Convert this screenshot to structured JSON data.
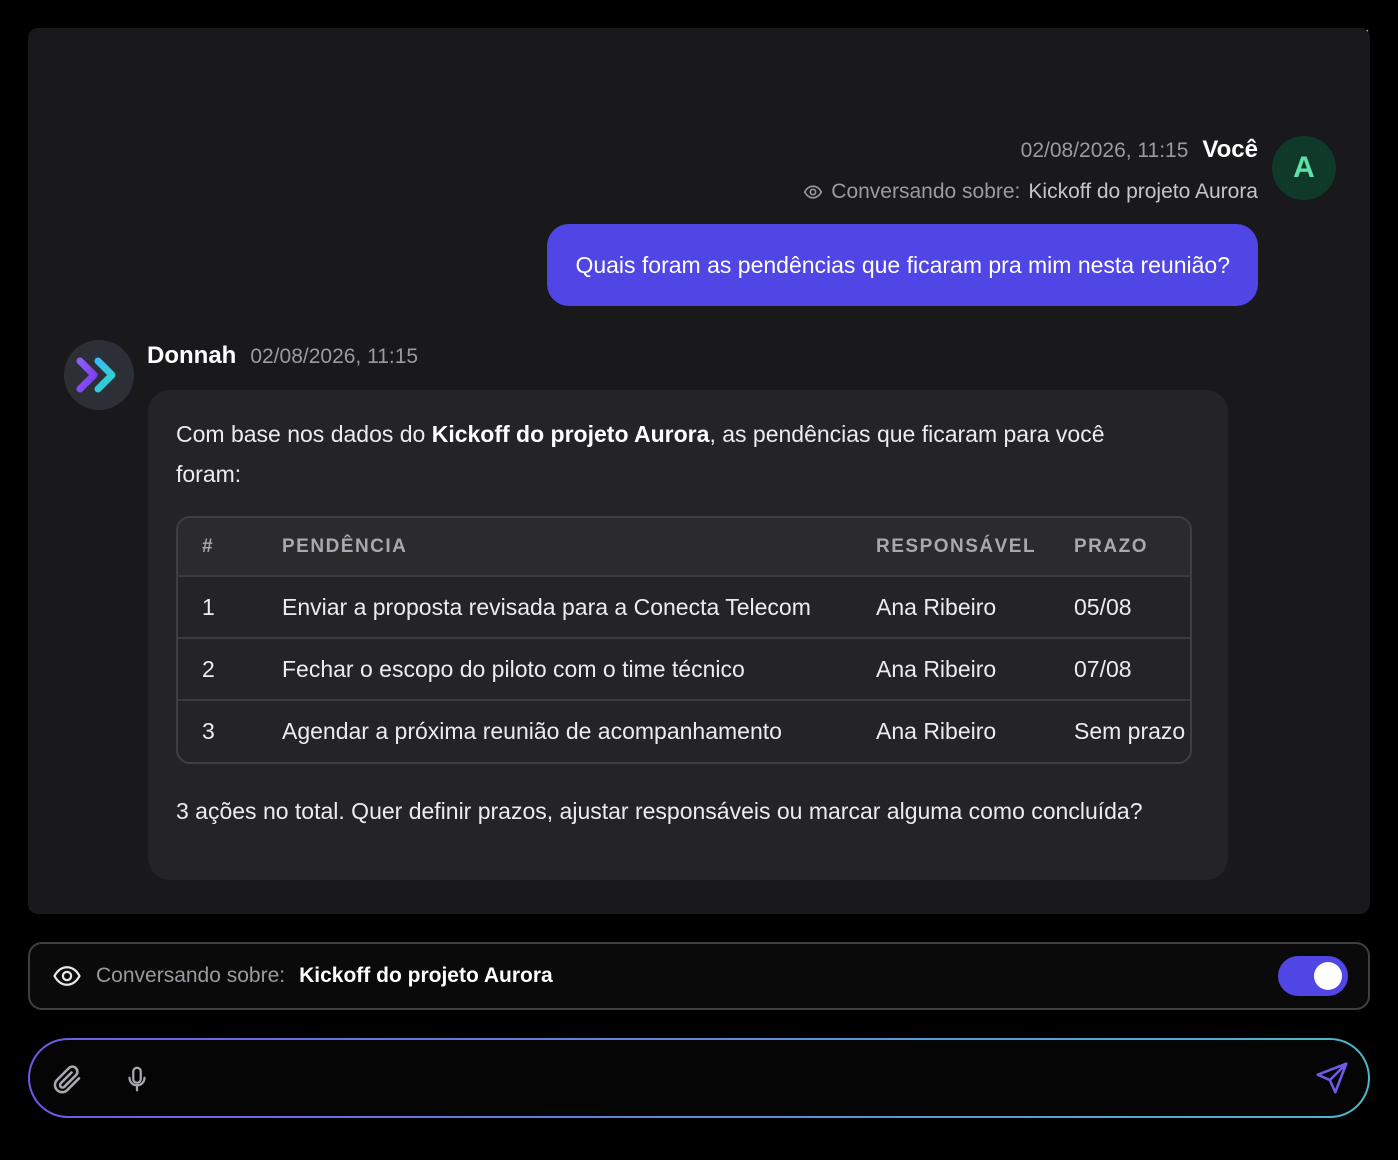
{
  "user_message": {
    "timestamp": "02/08/2026, 11:15",
    "author": "Você",
    "avatar_initial": "A",
    "context_label": "Conversando sobre:",
    "context_title": "Kickoff do projeto Aurora",
    "text": "Quais foram as pendências que ficaram pra mim nesta reunião?"
  },
  "assistant_message": {
    "author": "Donnah",
    "timestamp": "02/08/2026, 11:15",
    "intro_before": "Com base nos dados do ",
    "intro_bold": "Kickoff do projeto Aurora",
    "intro_after": ", as pendências que ficaram para você foram:",
    "table": {
      "headers": [
        "#",
        "PENDÊNCIA",
        "RESPONSÁVEL",
        "PRAZO"
      ],
      "rows": [
        [
          "1",
          "Enviar a proposta revisada para a Conecta Telecom",
          "Ana Ribeiro",
          "05/08"
        ],
        [
          "2",
          "Fechar o escopo do piloto com o time técnico",
          "Ana Ribeiro",
          "07/08"
        ],
        [
          "3",
          "Agendar a próxima reunião de acompanhamento",
          "Ana Ribeiro",
          "Sem prazo"
        ]
      ]
    },
    "outro": "3 ações no total. Quer definir prazos, ajustar responsáveis ou marcar alguma como concluída?"
  },
  "context_bar": {
    "label": "Conversando sobre:",
    "value": "Kickoff do projeto Aurora",
    "toggle_on": true
  },
  "composer": {
    "placeholder": ""
  },
  "icons": {
    "close": "close-icon",
    "eye": "eye-icon",
    "attach": "paperclip-icon",
    "mic": "microphone-icon",
    "send": "send-icon",
    "bot_logo": "double-chevron-icon"
  },
  "colors": {
    "accent": "#4f46e5",
    "user_avatar_bg": "#0f3a2a",
    "user_avatar_fg": "#5fe0a5",
    "panel_bg": "#19191b",
    "bubble_bg": "#242426"
  }
}
